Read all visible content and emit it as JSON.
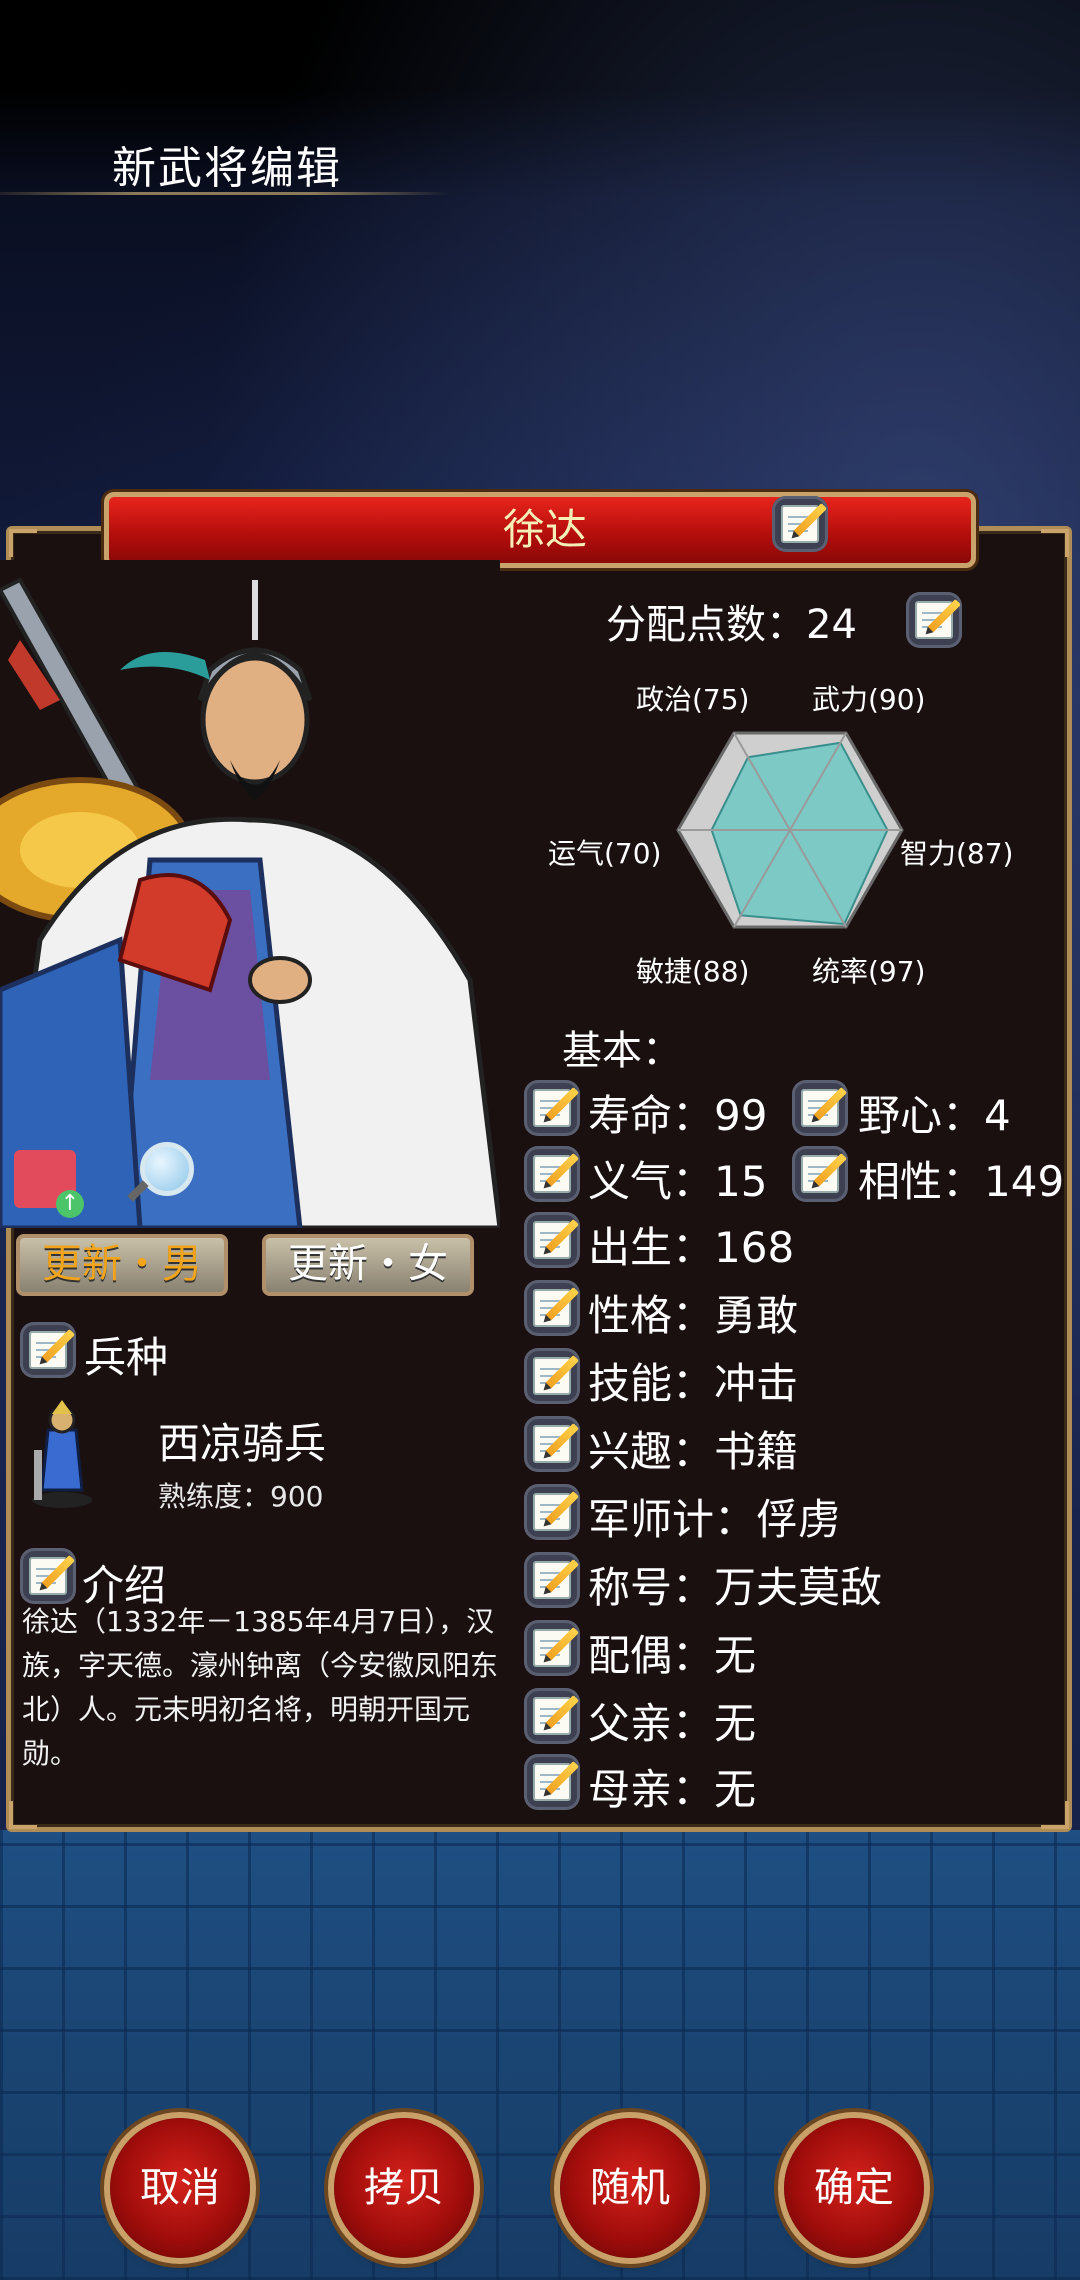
{
  "header": {
    "title": "新武将编辑"
  },
  "general": {
    "name": "徐达"
  },
  "points": {
    "label": "分配点数：",
    "value": "24"
  },
  "radar": {
    "stats": [
      {
        "label": "政治(75)",
        "value": 75
      },
      {
        "label": "武力(90)",
        "value": 90
      },
      {
        "label": "智力(87)",
        "value": 87
      },
      {
        "label": "统率(97)",
        "value": 97
      },
      {
        "label": "敏捷(88)",
        "value": 88
      },
      {
        "label": "运气(70)",
        "value": 70
      }
    ],
    "fill_color": "#7cc9c6",
    "frame_color": "#cfcfcf"
  },
  "buttons": {
    "update_male": "更新・男",
    "update_female": "更新・女",
    "cancel": "取消",
    "copy": "拷贝",
    "random": "随机",
    "confirm": "确定"
  },
  "troop": {
    "label": "兵种",
    "name": "西凉骑兵",
    "proficiency": "熟练度：900"
  },
  "intro": {
    "label": "介绍",
    "text": "徐达（1332年－1385年4月7日），汉族，字天德。濠州钟离（今安徽凤阳东北）人。元末明初名将，明朝开国元勋。"
  },
  "basic": {
    "title": "基本：",
    "lifespan": "寿命：99",
    "ambition": "野心：4",
    "loyalty": "义气：15",
    "compatibility": "相性：149",
    "birth": "出生：168",
    "personality": "性格：勇敢",
    "skill": "技能：冲击",
    "interest": "兴趣：书籍",
    "strategist": "军师计：俘虏",
    "title_name": "称号：万夫莫敌",
    "spouse": "配偶：无",
    "father": "父亲：无",
    "mother": "母亲：无"
  },
  "colors": {
    "accent_red": "#c8130f",
    "gold": "#c9a36a",
    "male_label": "#f2a51c"
  }
}
